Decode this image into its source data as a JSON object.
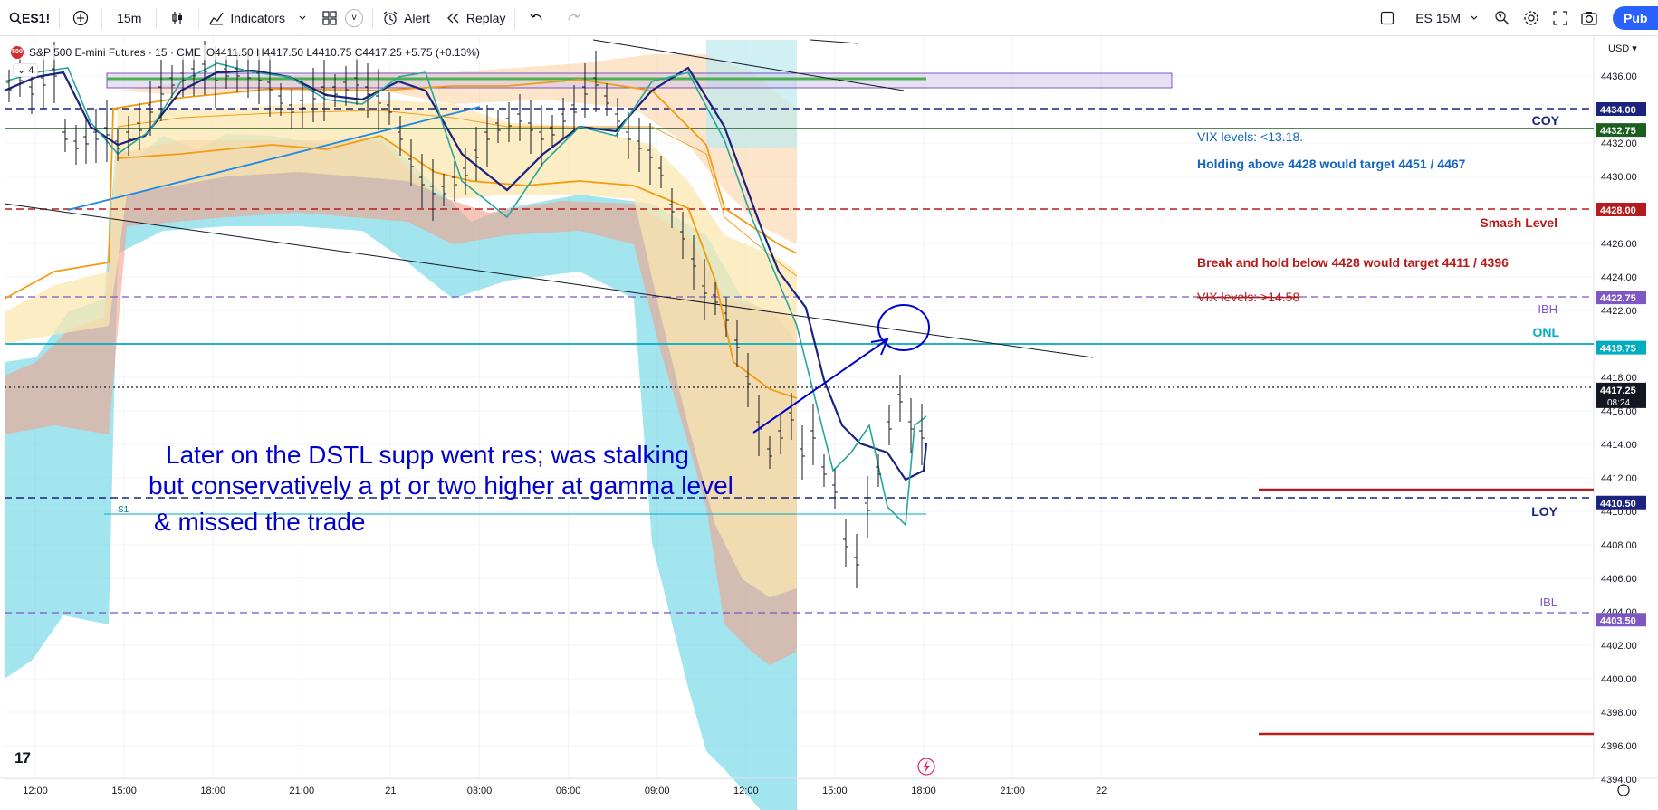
{
  "toolbar": {
    "symbol": "ES1!",
    "interval": "15m",
    "indicators_label": "Indicators",
    "templates_label": "v",
    "alert_label": "Alert",
    "replay_label": "Replay",
    "layout_name": "ES 15M",
    "publish_label": "Pub"
  },
  "legend": {
    "title": "S&P 500 E-mini Futures · 15 · CME",
    "ohlc": "O4411.50 H4417.50 L4410.75 C4417.25 +5.75 (+0.13%)",
    "symbol_badge": "500",
    "collapse_count": "4"
  },
  "price_axis": {
    "currency": "USD",
    "ticks": [
      "4436.00",
      "4434.00",
      "4432.00",
      "4430.00",
      "4428.00",
      "4426.00",
      "4424.00",
      "4422.00",
      "4418.00",
      "4416.00",
      "4414.00",
      "4412.00",
      "4410.00",
      "4408.00",
      "4406.00",
      "4404.00",
      "4402.00",
      "4400.00",
      "4398.00",
      "4396.00",
      "4394.00"
    ],
    "badges": [
      {
        "price": "4434.00",
        "color": "#1a237e"
      },
      {
        "price": "4432.75",
        "color": "#1b5e20"
      },
      {
        "price": "4428.00",
        "color": "#b71c1c"
      },
      {
        "price": "4422.75",
        "color": "#7e57c2"
      },
      {
        "price": "4419.75",
        "color": "#00acc1"
      },
      {
        "price": "4417.25",
        "color": "#131722",
        "sub": "08:24"
      },
      {
        "price": "4410.50",
        "color": "#1a237e"
      },
      {
        "price": "4403.50",
        "color": "#7e57c2"
      }
    ]
  },
  "time_axis": {
    "ticks": [
      "12:00",
      "15:00",
      "18:00",
      "21:00",
      "21",
      "03:00",
      "06:00",
      "09:00",
      "12:00",
      "15:00",
      "18:00",
      "21:00",
      "22"
    ]
  },
  "level_labels": {
    "coy": "COY",
    "smash": "Smash Level",
    "ibh": "IBH",
    "onl": "ONL",
    "loy": "LOY",
    "ibl": "IBL",
    "s1": "S1"
  },
  "notes": {
    "vix_low": "VIX levels: <13.18.",
    "holding_above": "Holding above 4428 would target 4451 / 4467",
    "break_hold": "Break and hold below 4428 would target 4411 / 4396",
    "vix_high": "VIX levels: >14.58"
  },
  "annotation": {
    "line1": "Later on the DSTL supp went res; was stalking",
    "line2": "but conservatively a pt or two higher at gamma level",
    "line3": "& missed the trade"
  },
  "colors": {
    "accent": "#2962ff",
    "annotation": "#0000cc",
    "up": "#089981",
    "level_red": "#b71c1c",
    "level_navy": "#1a237e",
    "level_teal": "#00acc1",
    "level_purple": "#7e57c2"
  }
}
